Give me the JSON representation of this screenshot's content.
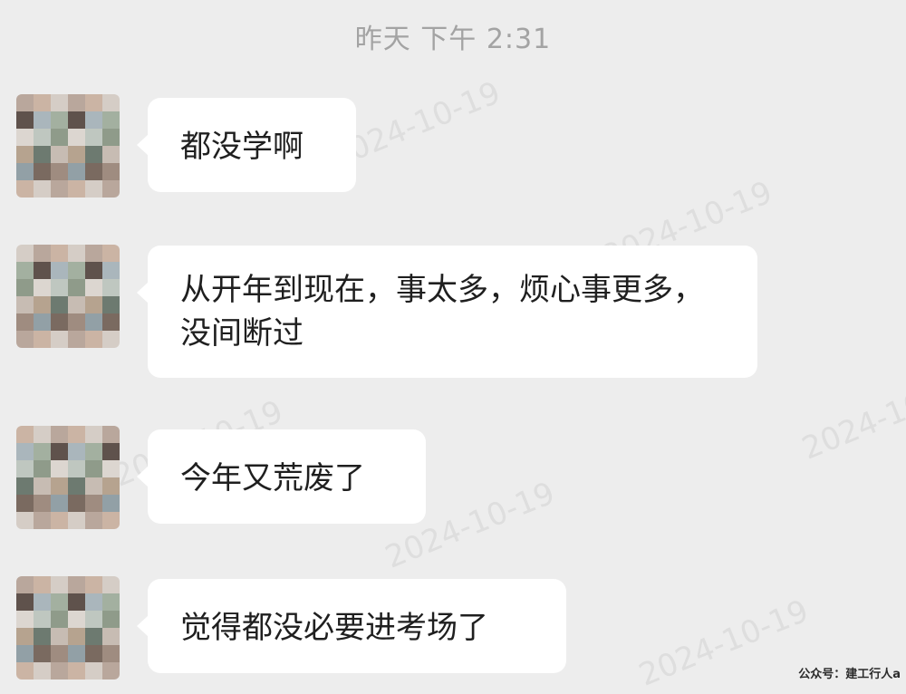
{
  "timestamp": "昨天 下午 2:31",
  "messages": [
    {
      "text": "都没学啊"
    },
    {
      "text": "从开年到现在，事太多，烦心事更多，没间断过"
    },
    {
      "text": "今年又荒废了"
    },
    {
      "text": "觉得都没必要进考场了"
    }
  ],
  "watermarks": [
    "2024-10-19",
    "2024-10-19",
    "2024-10-19",
    "2024-10-19",
    "2024-10-19",
    "2024-10-19"
  ],
  "credit": "公众号：建工行人a"
}
